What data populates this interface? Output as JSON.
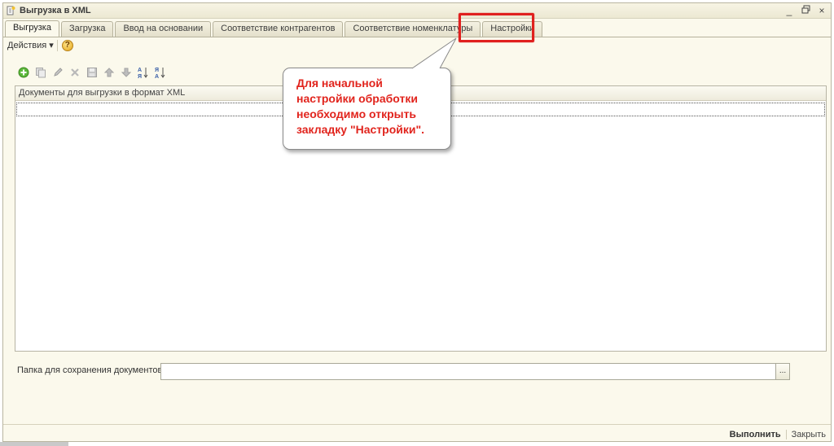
{
  "window": {
    "title": "Выгрузка  в XML",
    "controls": {
      "minimize": "_",
      "restore": "🗗",
      "close": "×"
    }
  },
  "tabs": [
    {
      "label": "Выгрузка",
      "active": true
    },
    {
      "label": "Загрузка"
    },
    {
      "label": "Ввод на основании"
    },
    {
      "label": "Соответствие контрагентов"
    },
    {
      "label": "Соответствие номенклатуры"
    },
    {
      "label": "Настройки",
      "highlighted": true
    }
  ],
  "actions": {
    "menu_label": "Действия ▾",
    "help_icon": "?"
  },
  "toolbar": {
    "icons": [
      "add-icon",
      "copy-icon",
      "edit-icon",
      "delete-icon",
      "save-icon",
      "move-up-icon",
      "move-down-icon",
      "sort-asc-icon",
      "sort-desc-icon"
    ]
  },
  "documents_table": {
    "header": "Документы для выгрузки в формат XML",
    "rows": []
  },
  "folder": {
    "label": "Папка для сохранения документов",
    "value": "",
    "browse_label": "..."
  },
  "buttons": {
    "run": "Выполнить",
    "close": "Закрыть"
  },
  "annotation": {
    "text_lines": [
      "Для начальной",
      "настройки обработки",
      "необходимо открыть",
      "закладку \"Настройки\"."
    ],
    "color": "#e1241d"
  }
}
